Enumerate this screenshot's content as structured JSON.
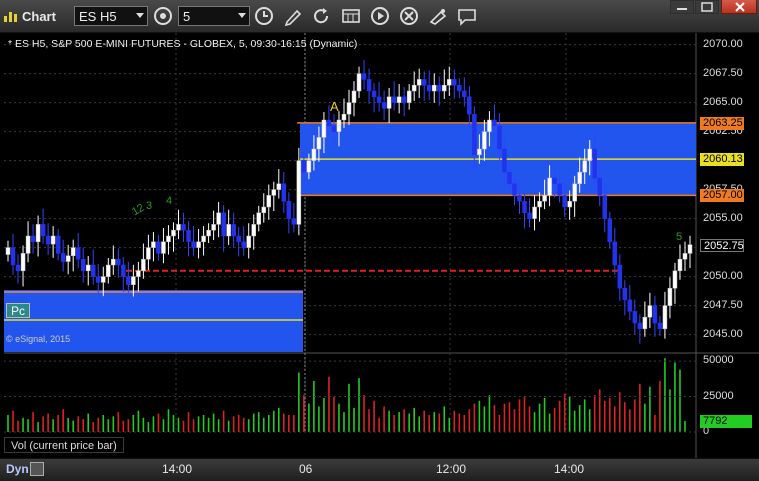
{
  "window": {
    "title": "Chart"
  },
  "toolbar": {
    "symbol": "ES H5",
    "interval": "5",
    "buttons": [
      {
        "icon": "link-settings-icon"
      },
      {
        "icon": "clock-icon"
      },
      {
        "icon": "pencil-icon"
      },
      {
        "icon": "refresh-icon"
      },
      {
        "icon": "spreadsheet-icon"
      },
      {
        "icon": "play-icon"
      },
      {
        "icon": "close-circle-icon"
      },
      {
        "icon": "draw-icon"
      },
      {
        "icon": "chat-icon"
      }
    ]
  },
  "chart": {
    "header": "* ES H5, S&P 500 E-MINI FUTURES - GLOBEX, 5, 09:30-16:15 (Dynamic)",
    "watermark": "© eSignal, 2015",
    "study_label": "Pc",
    "markers": [
      {
        "text": "A",
        "color": "#e8d020"
      },
      {
        "text": "12",
        "color": "#2a9a2a"
      },
      {
        "text": "3",
        "color": "#2a9a2a"
      },
      {
        "text": "4",
        "color": "#2a9a2a"
      },
      {
        "text": "5",
        "color": "#2a9a2a"
      }
    ],
    "price_axis": [
      "2070.00",
      "2067.50",
      "2065.00",
      "2062.50",
      "2060.00",
      "2057.50",
      "2055.00",
      "2052.50",
      "2050.00",
      "2047.50",
      "2045.00"
    ],
    "price_tags": [
      {
        "label": "2063.25",
        "bg": "#f07a20",
        "fg": "#000"
      },
      {
        "label": "2060.13",
        "bg": "#e8e020",
        "fg": "#000"
      },
      {
        "label": "2057.00",
        "bg": "#f07a20",
        "fg": "#000"
      },
      {
        "label": "2052.75",
        "bg": "#000000",
        "fg": "#fff"
      }
    ],
    "time_axis": [
      "14:00",
      "06",
      "12:00",
      "14:00"
    ]
  },
  "volume": {
    "label": "Vol (current price bar)",
    "axis": [
      "50000",
      "25000",
      "0"
    ],
    "tag": {
      "label": "7792",
      "bg": "#22cc22",
      "fg": "#000"
    }
  },
  "statusbar": {
    "mode": "Dyn"
  },
  "chart_data": {
    "type": "candlestick",
    "title": "ES H5, S&P 500 E-MINI FUTURES - GLOBEX, 5, 09:30-16:15 (Dynamic)",
    "ylim": [
      2043.5,
      2071
    ],
    "levels": {
      "upper": 2063.25,
      "mid": 2060.13,
      "lower": 2057.0,
      "prior_close_dashed": 2050.5
    },
    "last_price": 2052.75,
    "closes": [
      2052.5,
      2051,
      2050.5,
      2052,
      2053.5,
      2053,
      2054.5,
      2053.5,
      2052.8,
      2053.5,
      2052,
      2051.3,
      2051.8,
      2052.5,
      2051.5,
      2050.5,
      2051,
      2050,
      2049.5,
      2050,
      2051,
      2051.5,
      2051,
      2050,
      2049.3,
      2050,
      2050.5,
      2051.5,
      2052.5,
      2053,
      2052,
      2053,
      2053.5,
      2054,
      2054.5,
      2054,
      2053,
      2052.5,
      2053,
      2053.5,
      2054,
      2054.5,
      2055.5,
      2053.5,
      2054.5,
      2053.5,
      2053,
      2052.5,
      2053.5,
      2054.5,
      2055.5,
      2056,
      2057,
      2057.5,
      2058,
      2056.5,
      2055,
      2054.5,
      2060,
      2059,
      2060,
      2061,
      2062,
      2063.5,
      2063,
      2062.5,
      2063.5,
      2064,
      2065,
      2066,
      2067.5,
      2067,
      2066,
      2065.5,
      2065,
      2064.5,
      2065.5,
      2065,
      2065.5,
      2065,
      2066,
      2066.5,
      2067,
      2066.5,
      2066,
      2066.5,
      2066,
      2066.5,
      2067,
      2066.5,
      2066,
      2065.5,
      2064,
      2060.5,
      2061,
      2062.5,
      2063.5,
      2063,
      2061,
      2059,
      2058,
      2057,
      2056.5,
      2055.5,
      2055,
      2056,
      2056.5,
      2057,
      2058.5,
      2058,
      2057,
      2056,
      2056.5,
      2058,
      2059,
      2060,
      2061,
      2058.5,
      2057,
      2055,
      2053,
      2051,
      2049,
      2048,
      2047,
      2046,
      2045.5,
      2046.5,
      2047.5,
      2046,
      2045.5,
      2047.5,
      2049,
      2050.5,
      2051.5,
      2052,
      2052.75
    ],
    "volume": [
      12000,
      15000,
      8000,
      10000,
      9000,
      14000,
      7000,
      11000,
      13000,
      9000,
      12000,
      16000,
      10000,
      8000,
      11000,
      9000,
      13000,
      7000,
      10000,
      12000,
      9000,
      11000,
      14000,
      8000,
      9000,
      12000,
      15000,
      10000,
      7000,
      11000,
      13000,
      9000,
      16000,
      12000,
      10000,
      8000,
      14000,
      9000,
      11000,
      12000,
      10000,
      13000,
      9000,
      15000,
      8000,
      11000,
      12000,
      10000,
      9000,
      13000,
      14000,
      10000,
      12000,
      15000,
      17000,
      13000,
      12000,
      12000,
      42000,
      26000,
      20000,
      36000,
      18000,
      24000,
      39000,
      25000,
      20000,
      14000,
      34000,
      17000,
      38000,
      26000,
      16000,
      22000,
      10000,
      18000,
      15000,
      12000,
      14000,
      16000,
      13000,
      17000,
      11000,
      15000,
      12000,
      14000,
      13000,
      18000,
      10000,
      15000,
      13000,
      12000,
      16000,
      20000,
      22000,
      18000,
      26000,
      19000,
      12000,
      20000,
      21000,
      16000,
      23000,
      25000,
      18000,
      14000,
      20000,
      24000,
      13000,
      17000,
      22000,
      27000,
      25000,
      15000,
      19000,
      23000,
      16000,
      26000,
      30000,
      22000,
      24000,
      18000,
      28000,
      21000,
      16000,
      23000,
      34000,
      20000,
      32000,
      12000,
      36000,
      52000,
      30000,
      49000,
      44000,
      7792
    ]
  }
}
